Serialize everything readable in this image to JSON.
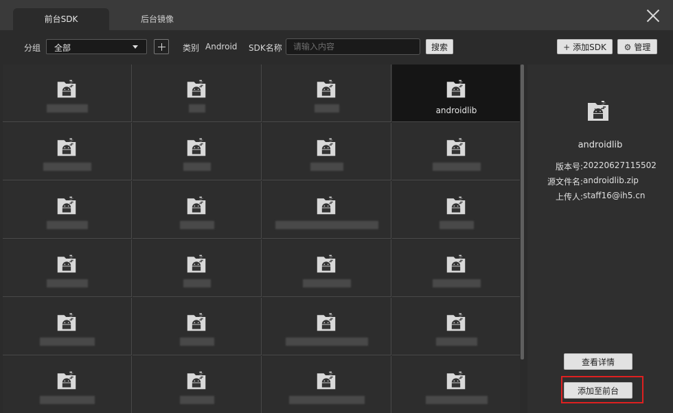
{
  "tabs": [
    {
      "label": "前台SDK",
      "active": true
    },
    {
      "label": "后台镜像",
      "active": false
    }
  ],
  "toolbar": {
    "group_label": "分组",
    "group_value": "全部",
    "category_label": "类别",
    "category_value": "Android",
    "sdk_name_label": "SDK名称",
    "search_placeholder": "请输入内容",
    "search_button": "搜索",
    "add_sdk_button": "添加SDK",
    "manage_button": "管理"
  },
  "grid": {
    "selected_name": "androidlib"
  },
  "detail": {
    "name": "androidlib",
    "version_label": "版本号:",
    "version_value": "20220627115502",
    "source_label": "源文件名:",
    "source_value": "androidlib.zip",
    "uploader_label": "上传人:",
    "uploader_value": "staff16@ih5.cn",
    "view_button": "查看详情",
    "add_front_button": "添加至前台"
  },
  "colors": {
    "highlight": "#e02020",
    "background": "#2b2b2b"
  }
}
